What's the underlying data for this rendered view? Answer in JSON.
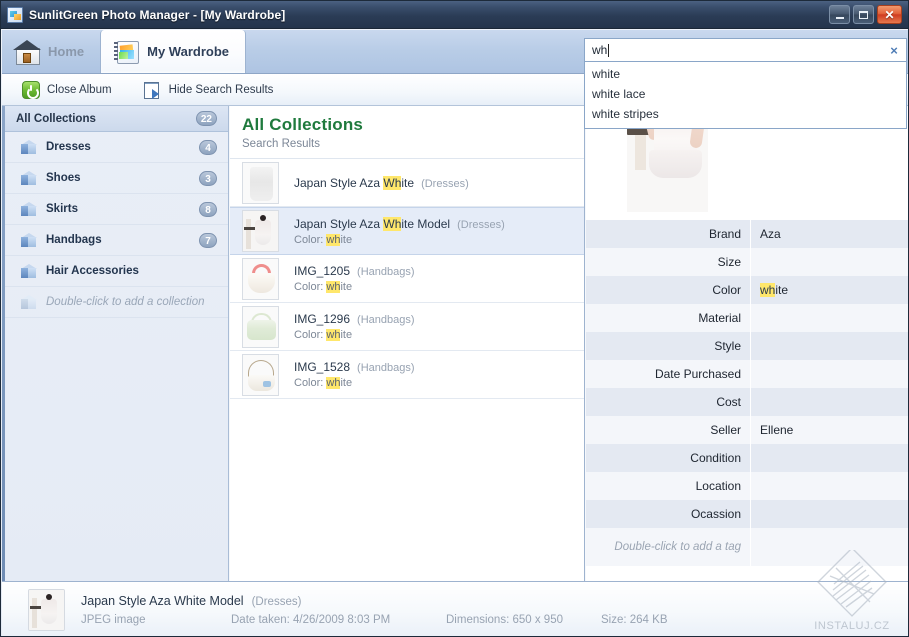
{
  "window": {
    "title": "SunlitGreen Photo Manager - [My Wardrobe]",
    "app_icon": "photo-album-icon",
    "minimize_label": "",
    "maximize_label": "",
    "close_label": "✕"
  },
  "tabs": [
    {
      "label": "Home",
      "icon": "house-icon",
      "active": false
    },
    {
      "label": "My Wardrobe",
      "icon": "photo-album-icon",
      "active": true
    }
  ],
  "toolbar": {
    "close_album_label": "Close Album",
    "close_album_icon": "power-icon",
    "hide_search_label": "Hide Search Results",
    "hide_search_icon": "hide-search-icon"
  },
  "search": {
    "value": "wh",
    "placeholder": "",
    "clear_label": "×",
    "suggestions": [
      "white",
      "white lace",
      "white stripes"
    ]
  },
  "sidebar": {
    "header": {
      "label": "All Collections",
      "count": "22"
    },
    "items": [
      {
        "label": "Dresses",
        "count": "4"
      },
      {
        "label": "Shoes",
        "count": "3"
      },
      {
        "label": "Skirts",
        "count": "8"
      },
      {
        "label": "Handbags",
        "count": "7"
      },
      {
        "label": "Hair Accessories",
        "count": ""
      }
    ],
    "add_placeholder": "Double-click to add a collection"
  },
  "results": {
    "title": "All Collections",
    "subtitle": "Search Results",
    "items": [
      {
        "name_pre": "Japan Style Aza ",
        "name_hl": "Wh",
        "name_post": "ite",
        "category": "(Dresses)",
        "detail_label": "",
        "detail_hl": "",
        "detail_post": "",
        "thumb": "dress-thumbnail",
        "selected": false
      },
      {
        "name_pre": "Japan Style Aza ",
        "name_hl": "Wh",
        "name_post": "ite Model",
        "category": "(Dresses)",
        "detail_label": "Color: ",
        "detail_hl": "wh",
        "detail_post": "ite",
        "thumb": "model-thumbnail",
        "selected": true
      },
      {
        "name_pre": "IMG_1205",
        "name_hl": "",
        "name_post": "",
        "category": "(Handbags)",
        "detail_label": "Color: ",
        "detail_hl": "wh",
        "detail_post": "ite",
        "thumb": "pink-handbag-thumbnail",
        "selected": false
      },
      {
        "name_pre": "IMG_1296",
        "name_hl": "",
        "name_post": "",
        "category": "(Handbags)",
        "detail_label": "Color: ",
        "detail_hl": "wh",
        "detail_post": "ite",
        "thumb": "green-handbag-thumbnail",
        "selected": false
      },
      {
        "name_pre": "IMG_1528",
        "name_hl": "",
        "name_post": "",
        "category": "(Handbags)",
        "detail_label": "Color: ",
        "detail_hl": "wh",
        "detail_post": "ite",
        "thumb": "white-handbag-thumbnail",
        "selected": false
      }
    ]
  },
  "properties": {
    "rows": [
      {
        "key": "Brand",
        "value": "Aza",
        "highlight": ""
      },
      {
        "key": "Size",
        "value": "",
        "highlight": ""
      },
      {
        "key": "Color",
        "value": "ite",
        "highlight": "wh"
      },
      {
        "key": "Material",
        "value": "",
        "highlight": ""
      },
      {
        "key": "Style",
        "value": "",
        "highlight": ""
      },
      {
        "key": "Date Purchased",
        "value": "",
        "highlight": ""
      },
      {
        "key": "Cost",
        "value": "",
        "highlight": ""
      },
      {
        "key": "Seller",
        "value": "Ellene",
        "highlight": ""
      },
      {
        "key": "Condition",
        "value": "",
        "highlight": ""
      },
      {
        "key": "Location",
        "value": "",
        "highlight": ""
      },
      {
        "key": "Ocassion",
        "value": "",
        "highlight": ""
      }
    ],
    "add_tag_placeholder": "Double-click to add a tag"
  },
  "watermark": {
    "label": "INSTALUJ.CZ"
  },
  "statusbar": {
    "name": "Japan Style Aza White Model",
    "category": "(Dresses)",
    "file_type": "JPEG image",
    "date_taken": "Date taken: 4/26/2009 8:03 PM",
    "dimensions": "Dimensions: 650 x 950",
    "size": "Size: 264 KB"
  },
  "colors": {
    "titlebar": "#2b3c56",
    "accent_green": "#1f7a3d",
    "highlight_yellow": "#ffe76b",
    "selection_blue": "#e5ecf8"
  }
}
